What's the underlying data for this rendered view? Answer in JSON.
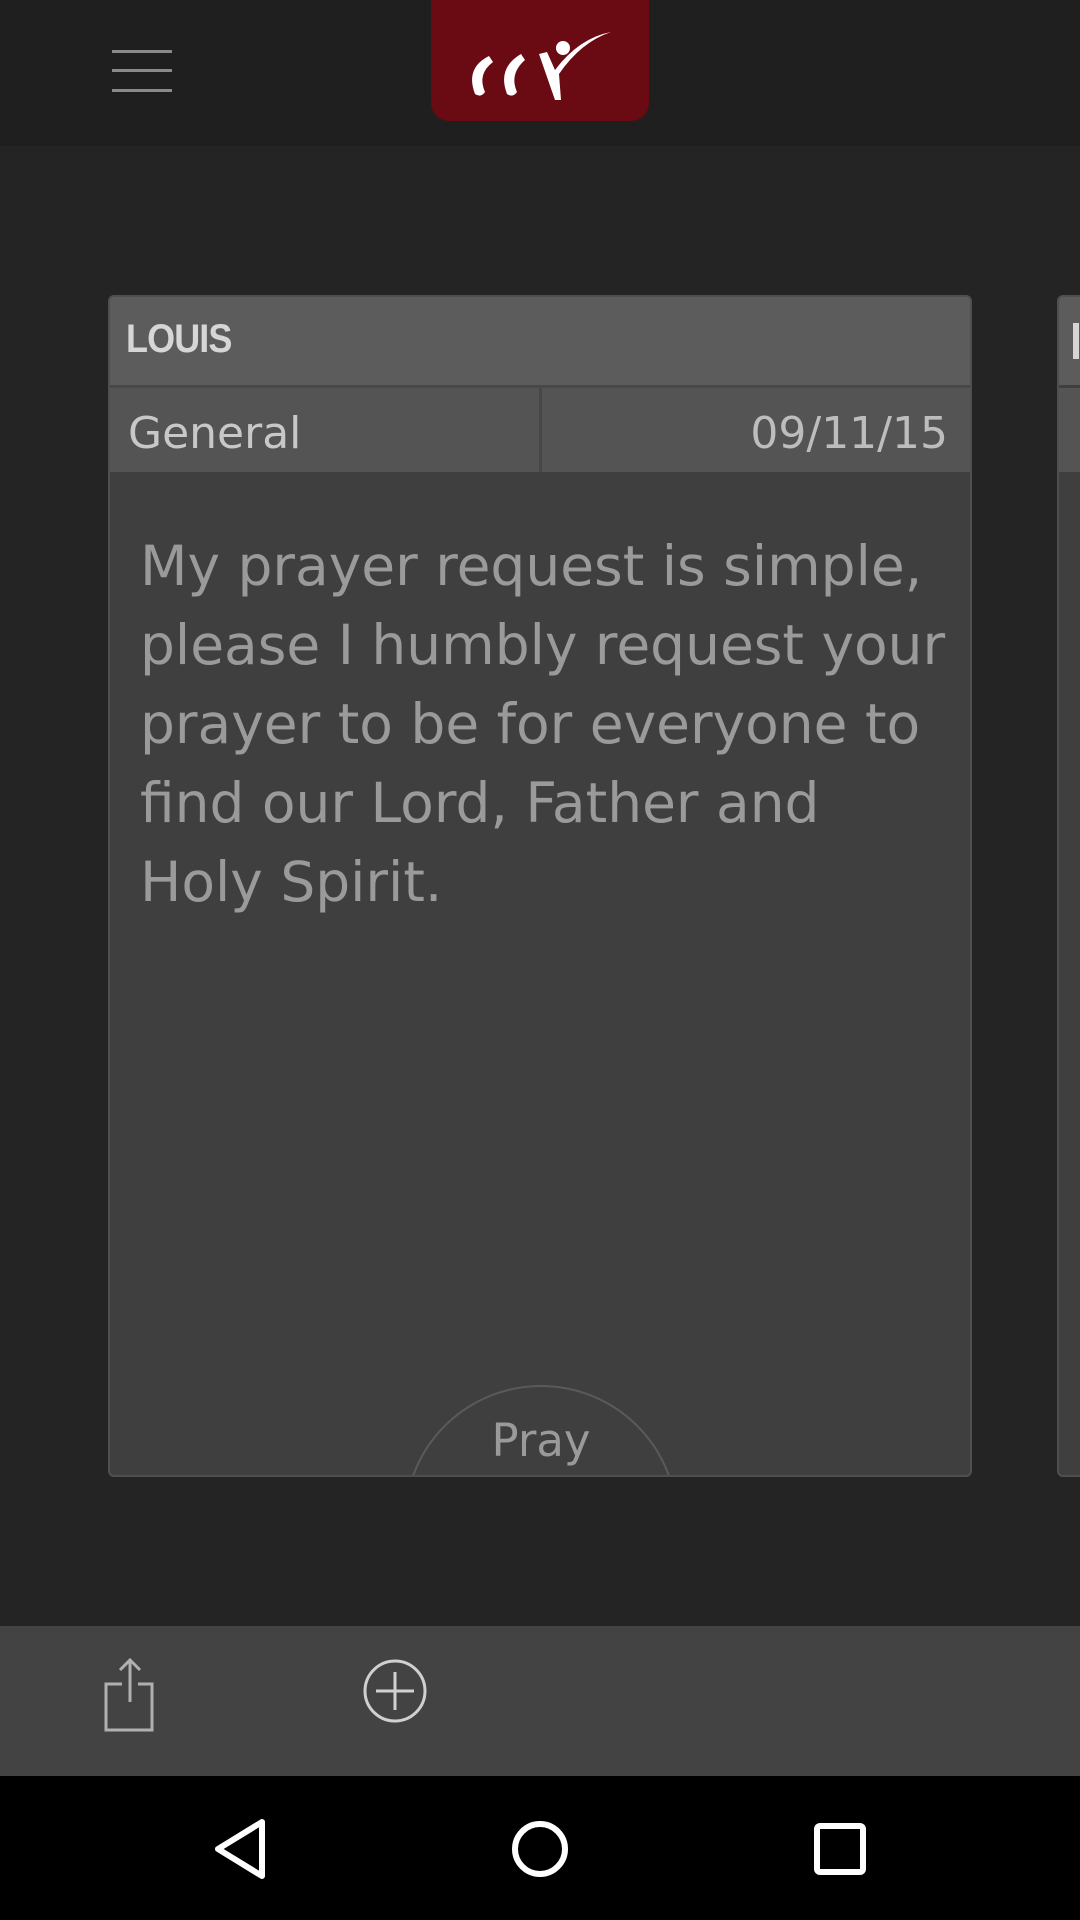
{
  "header": {
    "menu_icon": "hamburger-menu-icon",
    "logo_color": "#6a0a12",
    "logo_lettering": "ccv"
  },
  "card": {
    "name": "LOUIS",
    "category": "General",
    "date": "09/11/15",
    "message": "My prayer request is simple, please I humbly request your prayer to be for everyone to find our Lord, Father and Holy Spirit.",
    "pray_label": "Pray"
  },
  "toolbar": {
    "share_icon": "share-icon",
    "add_icon": "add-circle-icon"
  },
  "navigation": {
    "back_icon": "back-triangle-icon",
    "home_icon": "home-circle-icon",
    "recents_icon": "recents-square-icon"
  }
}
